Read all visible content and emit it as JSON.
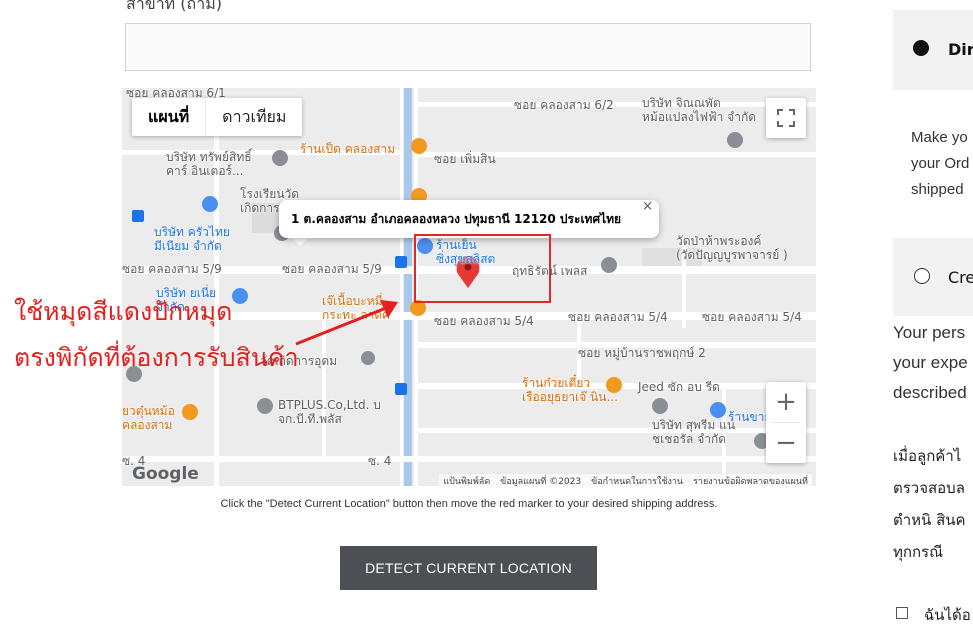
{
  "form": {
    "field_label": "สาขาที่ (ถ้ามี)",
    "field_value": ""
  },
  "map": {
    "type_buttons": [
      "แผนที่",
      "ดาวเทียม"
    ],
    "popup_address": "1 ต.คลองสาม อำเภอคลองหลวง ปทุมธานี 12120 ประเทศไทย",
    "popup_close": "×",
    "zoom_in": "+",
    "zoom_out": "−",
    "google_logo": "Google",
    "footer_items": [
      "แป้นพิมพ์ลัด",
      "ข้อมูลแผนที่ ©2023",
      "ข้อกำหนดในการใช้งาน",
      "รายงานข้อผิดพลาดของแผนที่"
    ],
    "labels": {
      "soi_6_1": "ซอย คลองสาม 6/1",
      "soi_6_2": "ซอย คลองสาม 6/2",
      "jinnaphat": "บริษัท จิณณพัต\nหม้อแปลงไฟฟ้า จำกัด",
      "sabsit": "บริษัท ทรัพย์สิทธิ์\nคาร์ อินเตอร์...",
      "ped": "ร้านเป็ด คลองสาม",
      "soi_permsin": "ซอย เพิ่มสิน",
      "school": "โรงเรียนวัด\nเกิดการ...",
      "kruathai": "บริษัท ครัวไทย\nมีเนียม จำกัด",
      "ranyen": "ร้านเย็น\nซิ่งสุขสลิสต",
      "watpa": "วัดป่าห้าพระองค์\n(วัดปัญญบูรพาจารย์ )",
      "soi_5_9a": "ซอย คลองสาม 5/9",
      "soi_5_9b": "ซอย คลองสาม 5/9",
      "ritthirat": "ฤทธิรัตน์ เพลส",
      "yenyi": "บริษัท ยเนี่ย\nจำกัด",
      "jenuea": "เจ๊เนื้อบะหมี่\nกระทะ ลาดิศ",
      "soi_5_4a": "ซอย คลองสาม 5/4",
      "soi_5_4b": "ซอย คลองสาม 5/4",
      "soi_5_4c": "ซอย คลองสาม 5/4",
      "watkoet": "วัดเกิดการอุดม",
      "mooban": "ซอย หมู่บ้านราชพฤกษ์ 2",
      "kuaytiao": "ร้านก๋วยเตี๋ยว\nเรืออยุธยาเจ๊ นิน...",
      "jeed": "Jeed ซัก อบ รีด",
      "raan": "ร้านขาย",
      "kuaytun": "ยวตุ๋นหม้อ\nคลองสาม",
      "btplus": "BTPLUS.Co,Ltd. บ\nจก.บี.ที.พลัส",
      "suprim": "บริษัท สุพรีม แน\nชเชอรัล จำกัด",
      "soi4a": "ซ. 4",
      "soi4b": "ซ. 4"
    }
  },
  "annotation": {
    "line1": "ใช้หมุดสีแดงปักหมุด",
    "line2": "ตรงพิกัดที่ต้องการรับสินค้า"
  },
  "caption": "Click the \"Detect Current Location\" button then move the red marker to your desired shipping address.",
  "detect_button": "DETECT CURRENT LOCATION",
  "payment": {
    "option1_title": "Dir",
    "option1_desc": [
      "Make yo",
      "your Ord",
      "shipped"
    ],
    "option2_title": "Cre",
    "privacy": [
      "Your pers",
      "your expe",
      "described"
    ],
    "thai_notice": [
      "เมื่อลูกค้าไ",
      "ตรวจสอบล",
      "ตำหนิ สินค",
      "ทุกกรณี"
    ],
    "agree_label": "ฉันได้อ"
  },
  "colors": {
    "button_bg": "#4d4f54",
    "annotation_red": "#e3201f",
    "marker_red": "#e53935"
  }
}
